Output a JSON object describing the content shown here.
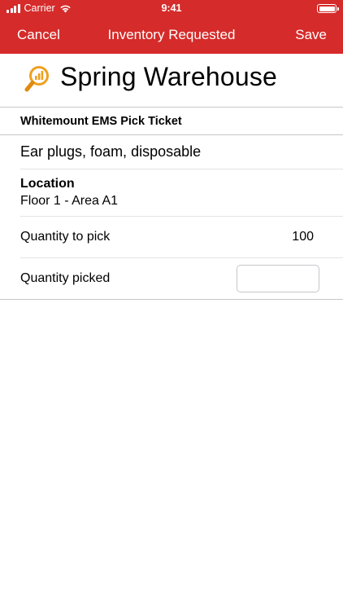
{
  "status_bar": {
    "carrier": "Carrier",
    "time": "9:41",
    "icons": [
      "signal-icon",
      "wifi-icon",
      "battery-icon"
    ]
  },
  "nav": {
    "cancel_label": "Cancel",
    "title": "Inventory Requested",
    "save_label": "Save"
  },
  "colors": {
    "accent": "#d52b2a",
    "logo_orange": "#f0a01e"
  },
  "header": {
    "logo_icon": "magnifier-chart-icon",
    "warehouse_name": "Spring Warehouse"
  },
  "ticket": {
    "section_title": "Whitemount EMS Pick Ticket",
    "item_name": "Ear plugs, foam, disposable",
    "location_label": "Location",
    "location_value": "Floor 1 - Area A1",
    "quantity_to_pick_label": "Quantity to pick",
    "quantity_to_pick_value": "100",
    "quantity_picked_label": "Quantity picked",
    "quantity_picked_value": ""
  }
}
